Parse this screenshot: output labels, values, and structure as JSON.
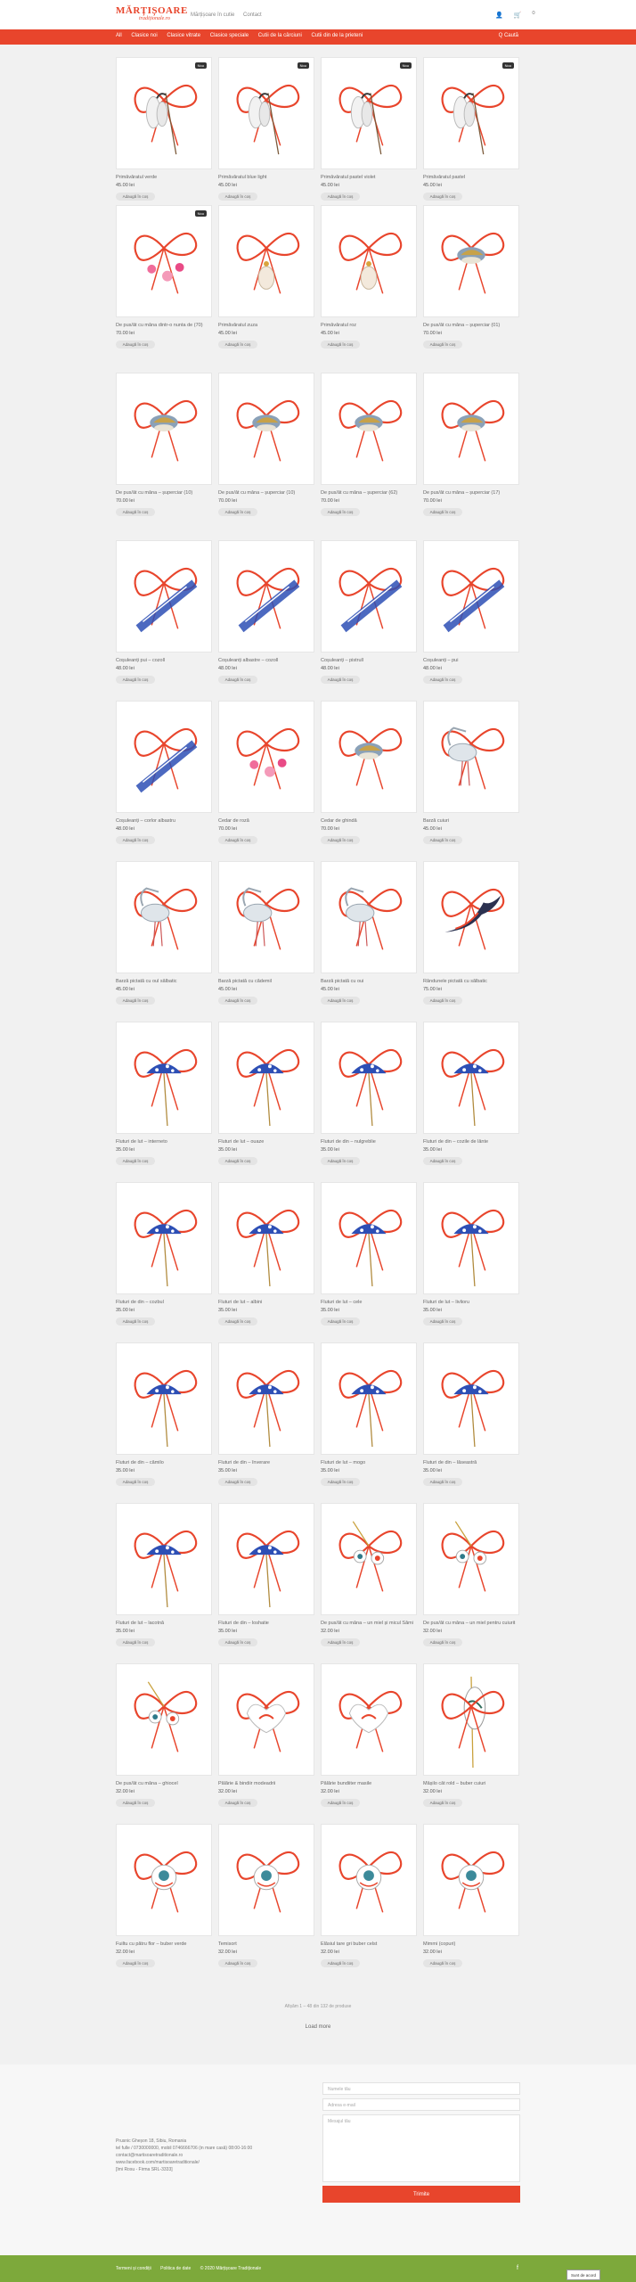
{
  "logo": {
    "line1": "MĂRȚIȘOARE",
    "line2": "tradiționale.ro"
  },
  "top_nav": [
    "Mărțișoare în cutie",
    "Contact"
  ],
  "top_icons": {
    "user": "👤",
    "cart": "🛒",
    "cart_count": "0"
  },
  "menu": [
    "All",
    "Clasice noi",
    "Clasice vitrate",
    "Clasice speciale",
    "Cutii de la cârciuni",
    "Cutii din de la prieteni"
  ],
  "search_label": "Q Caută",
  "badge_new": "Nou",
  "add_to_cart": "Adaugă în coș",
  "products": [
    {
      "name": "Primăvăratul verde",
      "price": "45.00 lei",
      "badge": true,
      "kind": "ghiocel"
    },
    {
      "name": "Primăvăratul blue light",
      "price": "45.00 lei",
      "badge": true,
      "kind": "ghiocel"
    },
    {
      "name": "Primăvăratul pastel violet",
      "price": "45.00 lei",
      "badge": true,
      "kind": "ghiocel"
    },
    {
      "name": "Primăvăratul pastel",
      "price": "45.00 lei",
      "badge": true,
      "kind": "ghiocel"
    },
    {
      "name": "De pus/ât cu mâna dintr-o nunta de (70)",
      "price": "70.00 lei",
      "badge": true,
      "kind": "pink"
    },
    {
      "name": "Primăvăratul zuza",
      "price": "45.00 lei",
      "badge": false,
      "kind": "bag"
    },
    {
      "name": "Primăvăratul roz",
      "price": "45.00 lei",
      "badge": false,
      "kind": "bag"
    },
    {
      "name": "De pus/ât cu mâna – șuperciar (01)",
      "price": "70.00 lei",
      "badge": false,
      "kind": "bird"
    },
    {
      "name": "De pus/ât cu mâna – șuperciar (10)",
      "price": "70.00 lei",
      "badge": false,
      "kind": "bird"
    },
    {
      "name": "De pus/ât cu mâna – șuperciar (10)",
      "price": "70.00 lei",
      "badge": false,
      "kind": "bird"
    },
    {
      "name": "De pus/ât cu mâna – șuperciar (62)",
      "price": "70.00 lei",
      "badge": false,
      "kind": "bird"
    },
    {
      "name": "De pus/ât cu mâna – șuperciar (17)",
      "price": "70.00 lei",
      "badge": false,
      "kind": "bird"
    },
    {
      "name": "Coșuleanți pui – cozoll",
      "price": "48.00 lei",
      "badge": false,
      "kind": "stripe"
    },
    {
      "name": "Coșuleanți albastre – cozoll",
      "price": "48.00 lei",
      "badge": false,
      "kind": "stripe"
    },
    {
      "name": "Coșuleanți – pistrull",
      "price": "48.00 lei",
      "badge": false,
      "kind": "stripe"
    },
    {
      "name": "Coșuleanți – pui",
      "price": "48.00 lei",
      "badge": false,
      "kind": "stripe"
    },
    {
      "name": "Coșuleanți – corlor albastru",
      "price": "48.00 lei",
      "badge": false,
      "kind": "stripe"
    },
    {
      "name": "Cedar de roză",
      "price": "70.00 lei",
      "badge": false,
      "kind": "pink"
    },
    {
      "name": "Cedar de ghindă",
      "price": "70.00 lei",
      "badge": false,
      "kind": "bird"
    },
    {
      "name": "Barză cuiuri",
      "price": "45.00 lei",
      "badge": false,
      "kind": "stork"
    },
    {
      "name": "Barză pictată cu oul sălbatic",
      "price": "45.00 lei",
      "badge": false,
      "kind": "stork"
    },
    {
      "name": "Barză pictată cu cădemil",
      "price": "45.00 lei",
      "badge": false,
      "kind": "stork"
    },
    {
      "name": "Barză pictată cu oui",
      "price": "45.00 lei",
      "badge": false,
      "kind": "stork"
    },
    {
      "name": "Rândunele pictată cu sălbatic",
      "price": "75.00 lei",
      "badge": false,
      "kind": "swallow"
    },
    {
      "name": "Fluturi de lut – interneto",
      "price": "35.00 lei",
      "badge": false,
      "kind": "blue"
    },
    {
      "name": "Fluturi de lut – ouaze",
      "price": "35.00 lei",
      "badge": false,
      "kind": "blue"
    },
    {
      "name": "Fluturi de din – nulgreblie",
      "price": "35.00 lei",
      "badge": false,
      "kind": "blue"
    },
    {
      "name": "Fluturi de din – cozile de lânte",
      "price": "35.00 lei",
      "badge": false,
      "kind": "blue"
    },
    {
      "name": "Fluturi de din – cozbul",
      "price": "35.00 lei",
      "badge": false,
      "kind": "blue"
    },
    {
      "name": "Fluturi de lut – albini",
      "price": "35.00 lei",
      "badge": false,
      "kind": "blue"
    },
    {
      "name": "Fluturi de lut – cele",
      "price": "35.00 lei",
      "badge": false,
      "kind": "blue"
    },
    {
      "name": "Fluturi de lut – livlioru",
      "price": "35.00 lei",
      "badge": false,
      "kind": "blue"
    },
    {
      "name": "Fluturi de din – cămilo",
      "price": "35.00 lei",
      "badge": false,
      "kind": "blue"
    },
    {
      "name": "Fluturi de din – înverare",
      "price": "35.00 lei",
      "badge": false,
      "kind": "blue"
    },
    {
      "name": "Fluturi de lut – mogo",
      "price": "35.00 lei",
      "badge": false,
      "kind": "blue"
    },
    {
      "name": "Fluturi de din – lăseastră",
      "price": "35.00 lei",
      "badge": false,
      "kind": "blue"
    },
    {
      "name": "Fluturi de lut – lacotnă",
      "price": "35.00 lei",
      "badge": false,
      "kind": "blue"
    },
    {
      "name": "Fluturi de din – loshatie",
      "price": "35.00 lei",
      "badge": false,
      "kind": "blue"
    },
    {
      "name": "De pus/ât cu mâna – un miel și micul Sămi",
      "price": "32.00 lei",
      "badge": false,
      "kind": "bells"
    },
    {
      "name": "De pus/ât cu mâna – un miel pentru cuiurit",
      "price": "32.00 lei",
      "badge": false,
      "kind": "bells"
    },
    {
      "name": "De pus/ât cu mâna – ghiocel",
      "price": "32.00 lei",
      "badge": false,
      "kind": "bells"
    },
    {
      "name": "Pălărie & bindiir modeadrii",
      "price": "32.00 lei",
      "badge": false,
      "kind": "heart"
    },
    {
      "name": "Pălărie bundiiter masile",
      "price": "32.00 lei",
      "badge": false,
      "kind": "heart"
    },
    {
      "name": "Mâșilo cât rold – buber cuiuri",
      "price": "32.00 lei",
      "badge": false,
      "kind": "leaf"
    },
    {
      "name": "Fuiltu cu pătru flor – buber verde",
      "price": "32.00 lei",
      "badge": false,
      "kind": "round"
    },
    {
      "name": "Temisort",
      "price": "32.00 lei",
      "badge": false,
      "kind": "round"
    },
    {
      "name": "Elăsiul tare gri buber celst",
      "price": "32.00 lei",
      "badge": false,
      "kind": "round"
    },
    {
      "name": "Mimmi (copuri)",
      "price": "32.00 lei",
      "badge": false,
      "kind": "round"
    }
  ],
  "shown_text": "Afișăm 1 – 48 din 132 de produse",
  "load_more": "Load more",
  "contact": {
    "address": "Prusnic Gheșon 18, Sibiu, Romania",
    "phone": "tel fulle / 0730000000, mobil 0746666706 (in mare casă) 08:00-16:00",
    "email": "contact@martisoaretraditionale.ro",
    "facebook": "www.facebook.com/martisoaretraditionale/",
    "company": "[Imi Rosu - Firma SRL-3333]",
    "name_placeholder": "Numele tău",
    "email_placeholder": "Adresa e-mail",
    "message_placeholder": "Mesajul tău",
    "send": "Trimite"
  },
  "footer": {
    "terms": "Termeni și condiții",
    "privacy": "Politica de date",
    "copyright": "© 2020 Mărțișoare Tradiționale",
    "fb_icon": "f"
  },
  "cookie_btn": "Sunt de acord",
  "colors": {
    "accent": "#e8452c",
    "footer": "#7da93b",
    "thread_red": "#e8452c",
    "clay_blue": "#2d4fb5"
  }
}
